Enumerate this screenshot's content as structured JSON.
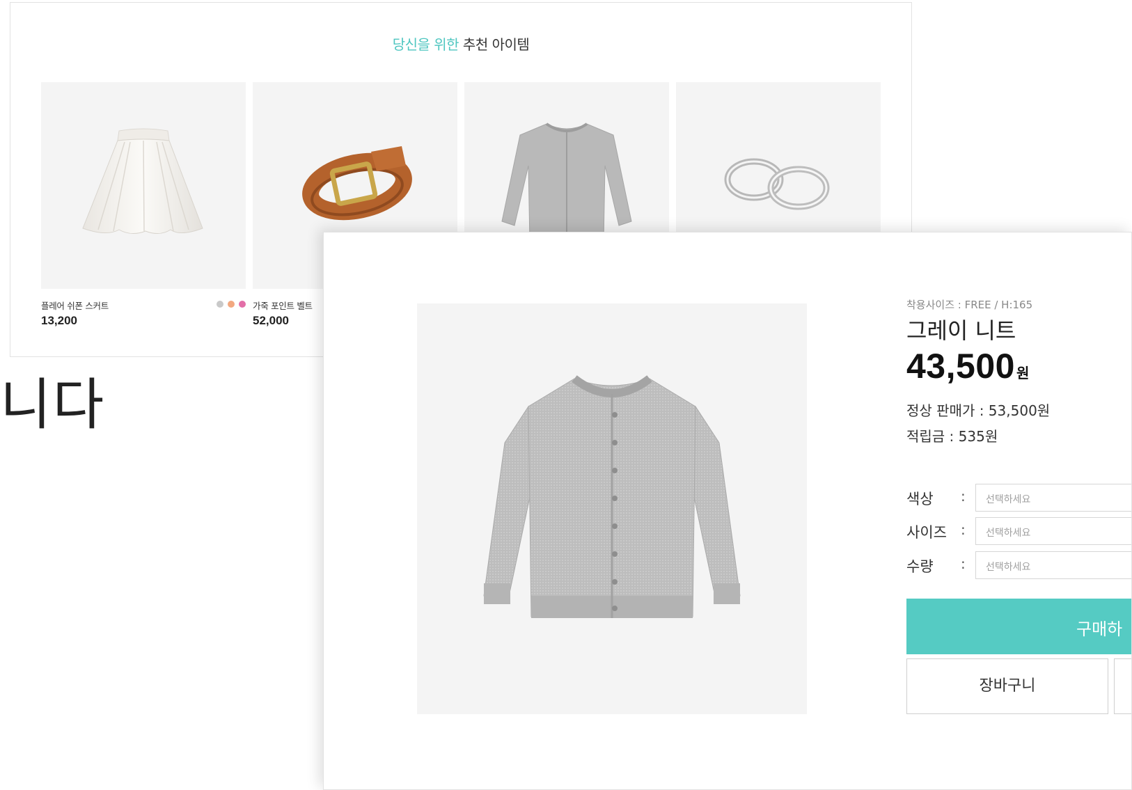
{
  "recommend": {
    "title_accent": "당신을 위한",
    "title_rest": "추천 아이템",
    "items": [
      {
        "name": "플레어 쉬폰 스커트",
        "price": "13,200",
        "image": "white-skirt",
        "colors": [
          "#c9c9c9",
          "#f2a880",
          "#e36fa8"
        ]
      },
      {
        "name": "가죽 포인트 벨트",
        "price": "52,000",
        "image": "brown-belt"
      },
      {
        "name": "",
        "price": "",
        "image": "gray-cardigan"
      },
      {
        "name": "",
        "price": "",
        "image": "silver-rings"
      }
    ]
  },
  "side_text": "니다",
  "product": {
    "fit_size": "착용사이즈 : FREE / H:165",
    "name": "그레이 니트",
    "price": "43,500",
    "price_unit": "원",
    "normal_price": "정상 판매가 : 53,500원",
    "points": "적립금 : 535원",
    "image": "gray-cardigan",
    "options": [
      {
        "label": "색상",
        "placeholder": "선택하세요"
      },
      {
        "label": "사이즈",
        "placeholder": "선택하세요"
      },
      {
        "label": "수량",
        "placeholder": "선택하세요"
      }
    ],
    "buy_label": "구매하",
    "cart_label": "장바구니"
  },
  "colors": {
    "accent": "#4ec6c0",
    "buy_button": "#55cbc3",
    "thumb_bg": "#f4f4f4"
  }
}
